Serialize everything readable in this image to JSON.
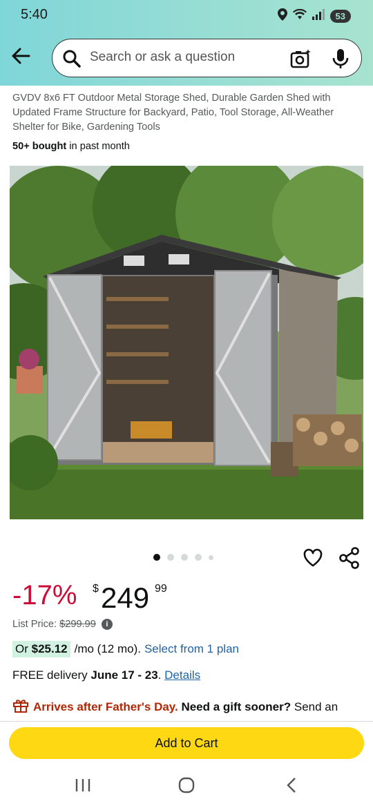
{
  "status": {
    "time": "5:40",
    "battery": "53"
  },
  "search": {
    "placeholder": "Search or ask a question"
  },
  "product": {
    "title": "GVDV 8x6 FT Outdoor Metal Storage Shed, Durable Garden Shed with Updated Frame Structure for Backyard, Patio, Tool Storage, All-Weather Shelter for Bike, Gardening Tools",
    "bought_count": "50+ bought",
    "bought_suffix": " in past month"
  },
  "carousel": {
    "total": 5,
    "active": 1
  },
  "price": {
    "discount": "-17%",
    "symbol": "$",
    "whole": "249",
    "fraction": "99",
    "list_label": "List Price: ",
    "list_value": "$299.99"
  },
  "monthly": {
    "prefix": "Or ",
    "amount": "$25.12",
    "suffix": "/mo (12 mo).",
    "link": "Select from 1 plan"
  },
  "delivery": {
    "prefix": "FREE delivery ",
    "dates": "June 17 - 23",
    "separator": ". ",
    "link": "Details"
  },
  "gift": {
    "arrives": "Arrives after Father's Day.",
    "question": " Need a gift sooner?",
    "suffix": " Send an Amazon Gift Card instantly by email or text."
  },
  "cart": {
    "label": "Add to Cart"
  },
  "colors": {
    "accent_button": "#ffd814",
    "discount": "#cc0c39",
    "link": "#2162a1",
    "header_gradient_start": "#7fd6d8",
    "header_gradient_end": "#a7e3cf"
  }
}
